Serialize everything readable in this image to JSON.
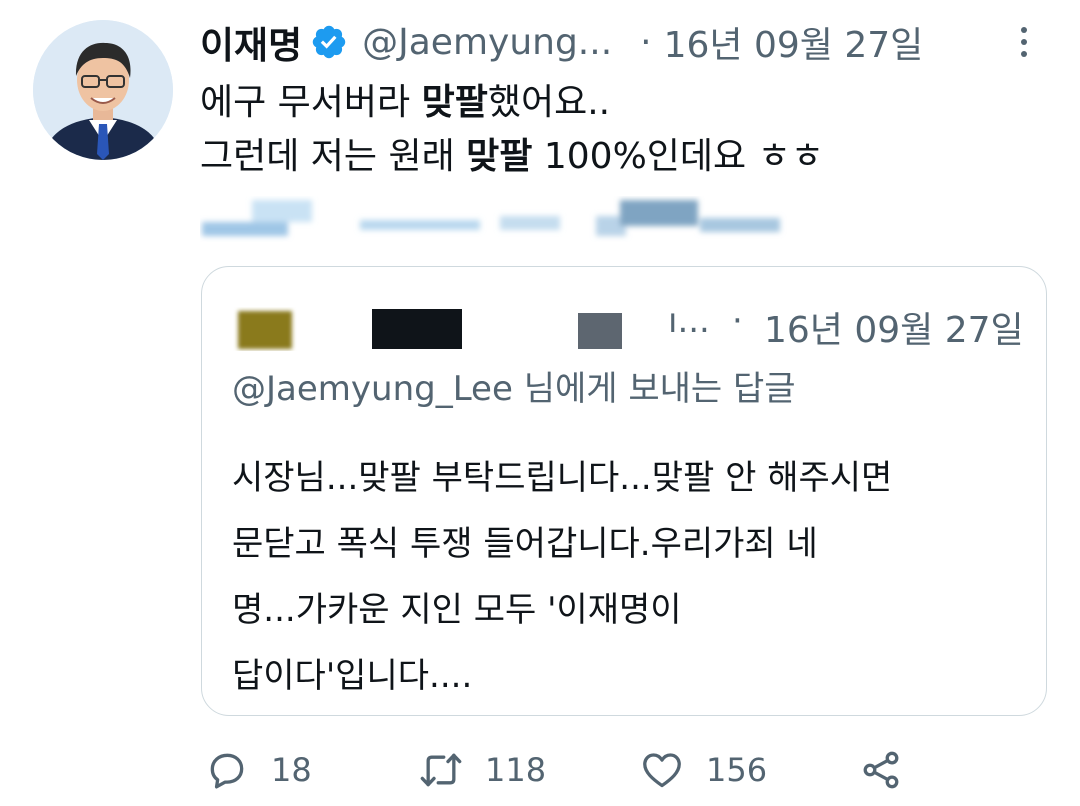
{
  "tweet": {
    "author_name": "이재명",
    "handle": "@Jaemyung...",
    "separator": "·",
    "date": "16년 09월 27일",
    "text_lines": [
      {
        "before": "에구 무서버라 ",
        "bold": "맞팔",
        "after": "했어요.."
      },
      {
        "before": "그런데 저는 원래 ",
        "bold": "맞팔",
        "after": " 100%인데요 ㅎㅎ"
      }
    ]
  },
  "quoted": {
    "name_truncation": "ı...",
    "separator": "·",
    "date": "16년 09월 27일",
    "reply_to": "@Jaemyung_Lee 님에게 보내는 답글",
    "body_lines": [
      "시장님...맞팔 부탁드립니다...맞팔 안 해주시면",
      "문닫고 폭식 투쟁 들어갑니다.우리가죄 네",
      "명...가카운 지인 모두 '이재명이",
      "답이다'입니다...."
    ]
  },
  "actions": {
    "reply_count": "18",
    "retweet_count": "118",
    "like_count": "156"
  },
  "colors": {
    "primary_text": "#0f1419",
    "secondary_text": "#536471",
    "verified_blue": "#1d9bf0",
    "border": "#cfd9de"
  },
  "icons": [
    "verified-badge-icon",
    "more-options-icon",
    "reply-icon",
    "retweet-icon",
    "like-icon",
    "share-icon"
  ]
}
